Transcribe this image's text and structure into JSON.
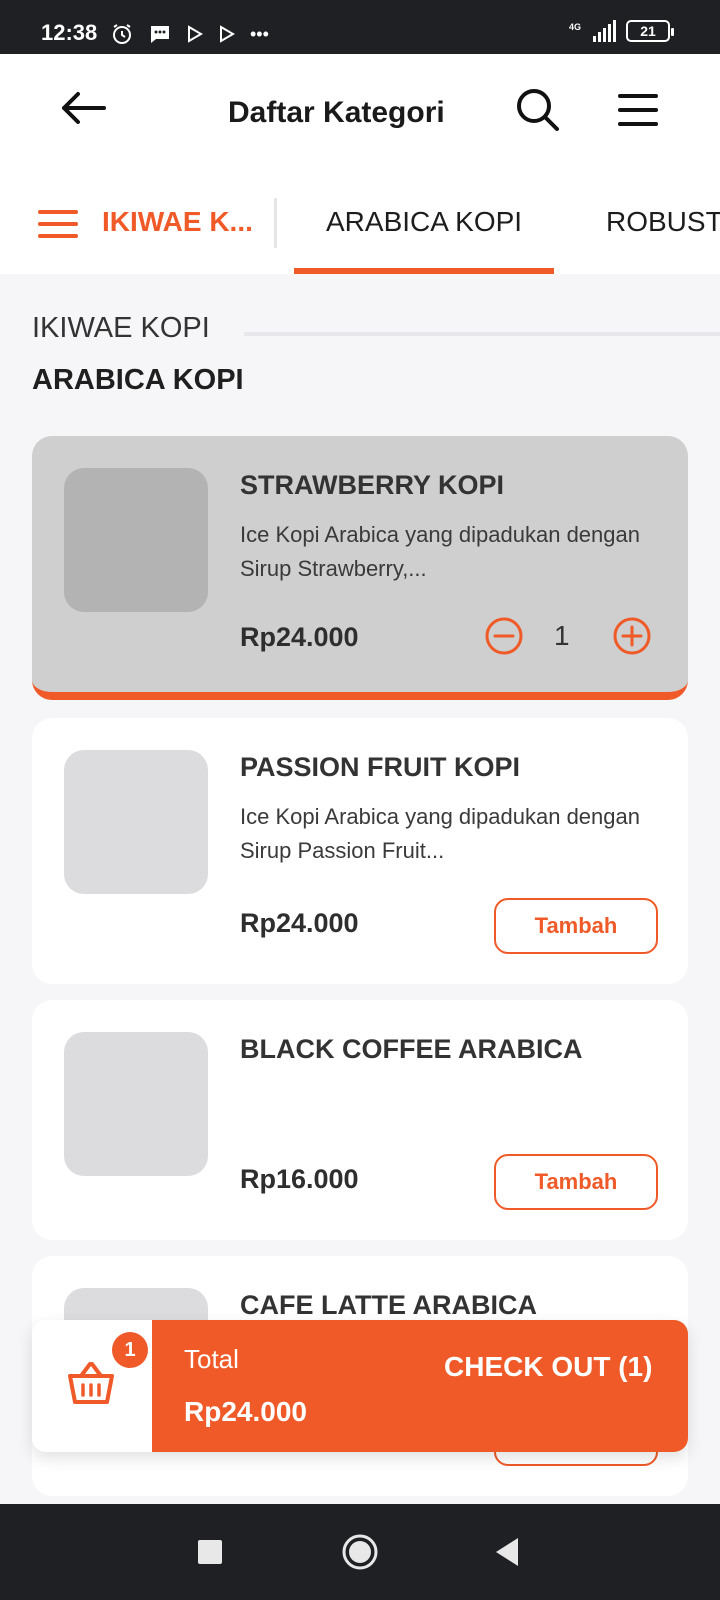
{
  "status_bar": {
    "time": "12:38",
    "network": "4G",
    "battery": "21",
    "more": "•••"
  },
  "header": {
    "title": "Daftar Kategori",
    "icons": [
      "arrow-left-icon",
      "search-icon",
      "hamburger-menu-icon"
    ]
  },
  "tabs": {
    "current_category": "IKIWAE K...",
    "items": [
      {
        "label": "ARABICA KOPI",
        "active": true
      },
      {
        "label": "ROBUSTA",
        "active": false
      }
    ]
  },
  "section": {
    "breadcrumb": "IKIWAE KOPI",
    "title": "ARABICA KOPI"
  },
  "products": [
    {
      "name": "STRAWBERRY KOPI",
      "description": "Ice Kopi Arabica yang dipadukan dengan Sirup Strawberry,...",
      "price": "Rp24.000",
      "quantity": "1",
      "in_cart": true
    },
    {
      "name": "PASSION FRUIT KOPI",
      "description": "Ice Kopi Arabica yang dipadukan dengan Sirup Passion Fruit...",
      "price": "Rp24.000",
      "action": "Tambah"
    },
    {
      "name": "BLACK COFFEE ARABICA",
      "description": "",
      "price": "Rp16.000",
      "action": "Tambah"
    },
    {
      "name": "CAFE LATTE ARABICA",
      "description": "",
      "price": "",
      "action": "Tambah"
    }
  ],
  "checkout": {
    "cart_count": "1",
    "total_label": "Total",
    "total_value": "Rp24.000",
    "button_label": "CHECK OUT (1)"
  },
  "colors": {
    "accent": "#ef5a28",
    "selected_card": "#cfcfcf",
    "background": "#f6f6f8"
  }
}
